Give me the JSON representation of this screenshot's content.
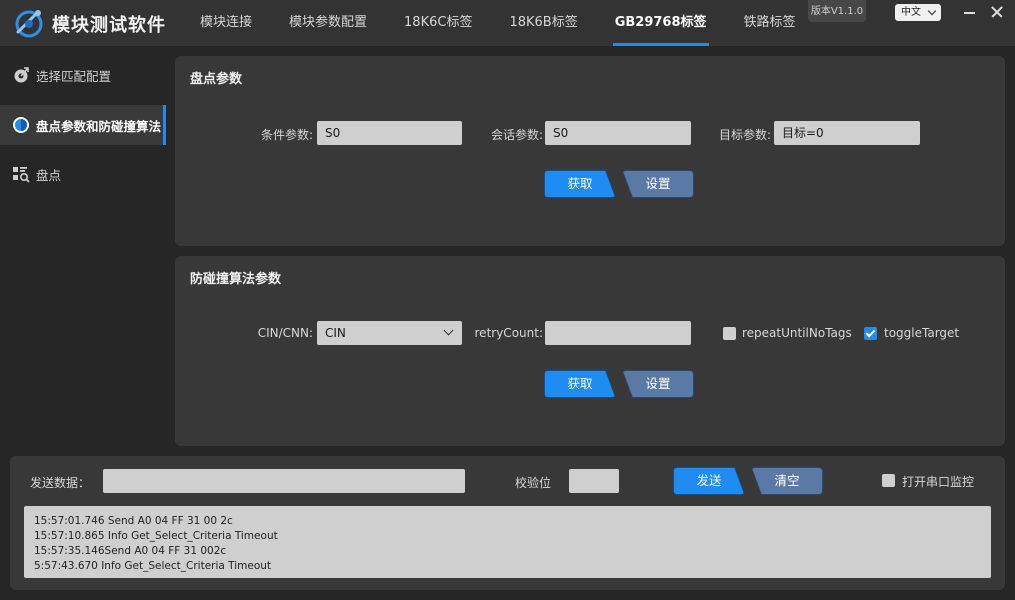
{
  "app": {
    "title": "模块测试软件",
    "version": "版本V1.1.0",
    "language": "中文"
  },
  "nav": {
    "tabs": [
      "模块连接",
      "模块参数配置",
      "18K6C标签",
      "18K6B标签",
      "GB29768标签",
      "铁路标签"
    ],
    "active_index": 4
  },
  "sidebar": {
    "items": [
      {
        "label": "选择匹配配置",
        "icon": "target-gear-icon"
      },
      {
        "label": "盘点参数和防碰撞算法",
        "icon": "circle-toggle-icon"
      },
      {
        "label": "盘点",
        "icon": "inventory-search-icon"
      }
    ],
    "active_index": 1
  },
  "inventory_panel": {
    "title": "盘点参数",
    "condition_label": "条件参数:",
    "condition_value": "S0",
    "session_label": "会话参数:",
    "session_value": "S0",
    "target_label": "目标参数:",
    "target_value": "目标=0",
    "get_label": "获取",
    "set_label": "设置"
  },
  "anticollision_panel": {
    "title": "防碰撞算法参数",
    "cin_label": "CIN/CNN:",
    "cin_value": "CIN",
    "retry_label": "retryCount:",
    "retry_value": "",
    "repeat_label": "repeatUntilNoTags",
    "repeat_checked": false,
    "toggle_label": "toggleTarget",
    "toggle_checked": true,
    "get_label": "获取",
    "set_label": "设置"
  },
  "bottom": {
    "send_label": "发送数据：",
    "send_value": "",
    "checksum_label": "校验位",
    "checksum_value": "",
    "send_button": "发送",
    "clear_button": "清空",
    "monitor_label": "打开串口监控",
    "monitor_checked": false,
    "log": [
      "15:57:01.746 Send A0 04 FF 31 00 2c",
      "15:57:10.865 Info Get_Select_Criteria Timeout",
      "15:57:35.146Send A0 04 FF 31 002c",
      "5:57:43.670 Info Get_Select_Criteria Timeout"
    ]
  },
  "colors": {
    "accent": "#1e8cf0",
    "secondary_button": "#5a7aa5",
    "panel": "#383838",
    "background": "#262626"
  }
}
